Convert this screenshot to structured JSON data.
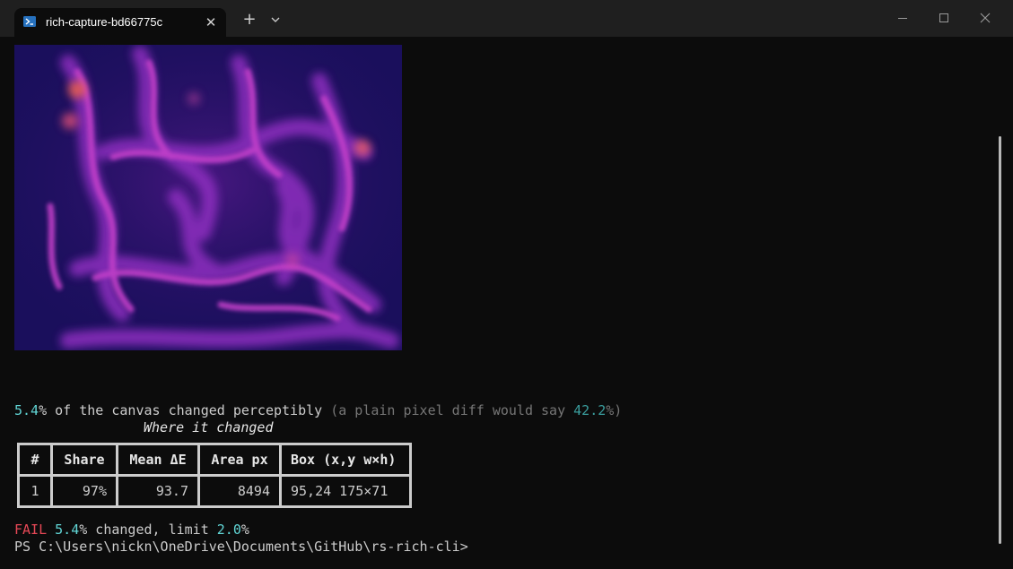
{
  "window": {
    "tab_title": "rich-capture-bd66775c",
    "tab_close_glyph": "✕",
    "new_tab_glyph": "+",
    "accent_color": "#0078d4",
    "background_color": "#0c0c0c"
  },
  "terminal": {
    "summary": {
      "changed_pct": "5.4",
      "text_mid": "% of the canvas changed perceptibly ",
      "paren_open": "(a plain pixel diff would say ",
      "pixel_diff_pct": "42.2",
      "paren_close": "%)"
    },
    "subtitle": "Where it changed",
    "table": {
      "headers": [
        "#",
        "Share",
        "Mean ΔE",
        "Area px",
        "Box (x,y w×h)"
      ],
      "rows": [
        [
          "1",
          "97%",
          "93.7",
          "8494",
          "95,24 175×71"
        ]
      ]
    },
    "result": {
      "status": "FAIL",
      "changed_pct": "5.4",
      "text_mid": "% changed, limit ",
      "limit_pct": "2.0",
      "suffix": "%"
    },
    "prompt": "PS C:\\Users\\nickn\\OneDrive\\Documents\\GitHub\\rs-rich-cli>"
  },
  "colors": {
    "teal": "#61d6d6",
    "fail_red": "#e74856",
    "heatmap_low": "#1a0f5c",
    "heatmap_high": "#ff6a3d"
  },
  "icons": [
    "powershell-icon",
    "close-icon",
    "plus-icon",
    "chevron-down-icon",
    "minimize-icon",
    "maximize-icon",
    "window-close-icon"
  ]
}
